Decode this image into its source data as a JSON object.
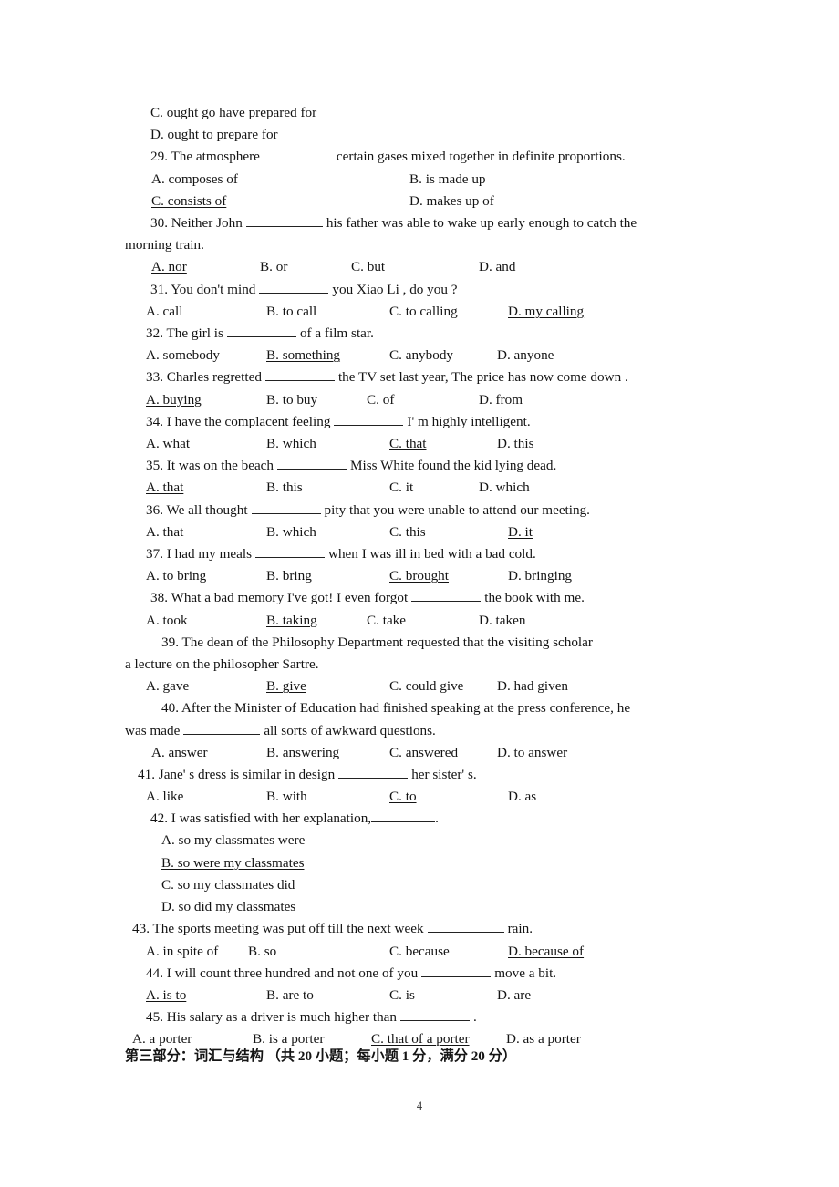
{
  "document": {
    "page_number": "4",
    "section_heading": "第三部分：词汇与结构 （共 20 小题；每小题 1 分，满分 20 分）"
  },
  "carryover": {
    "option_c": "C. ought go have prepared for",
    "option_d": "D. ought to prepare for"
  },
  "questions": [
    {
      "number": "29",
      "stem_before": "29. The atmosphere",
      "stem_after": "certain gases mixed together in definite proportions.",
      "layout": "two-column",
      "options": [
        {
          "label": "A. composes of",
          "correct": false
        },
        {
          "label": "B. is made up",
          "correct": false
        },
        {
          "label": "C. consists of",
          "correct": true
        },
        {
          "label": "D. makes up of",
          "correct": false
        }
      ]
    },
    {
      "number": "30",
      "stem_before": "30. Neither John",
      "stem_after": "his father was able to wake up early enough to catch the",
      "stem_tail": "morning train.",
      "layout": "four-column",
      "options": [
        {
          "label": "A. nor",
          "correct": true
        },
        {
          "label": "B. or",
          "correct": false
        },
        {
          "label": "C. but",
          "correct": false
        },
        {
          "label": "D. and",
          "correct": false
        }
      ]
    },
    {
      "number": "31",
      "stem_before": "31. You don't mind",
      "stem_after": "you Xiao Li , do you ?",
      "layout": "four-column",
      "options": [
        {
          "label": "A. call",
          "correct": false
        },
        {
          "label": "B. to call",
          "correct": false
        },
        {
          "label": "C. to calling",
          "correct": false
        },
        {
          "label": "D. my calling",
          "correct": true
        }
      ]
    },
    {
      "number": "32",
      "stem_before": "32. The girl is",
      "stem_after": "of a film star.",
      "layout": "four-column",
      "options": [
        {
          "label": "A. somebody",
          "correct": false
        },
        {
          "label": "B. something",
          "correct": true
        },
        {
          "label": "C. anybody",
          "correct": false
        },
        {
          "label": "D. anyone",
          "correct": false
        }
      ]
    },
    {
      "number": "33",
      "stem_before": "33. Charles regretted",
      "stem_after": "the TV set last year, The price has now come down .",
      "layout": "four-column",
      "options": [
        {
          "label": "A. buying",
          "correct": true
        },
        {
          "label": "B. to buy",
          "correct": false
        },
        {
          "label": "C. of",
          "correct": false
        },
        {
          "label": "D. from",
          "correct": false
        }
      ]
    },
    {
      "number": "34",
      "stem_before": "34. I have the complacent feeling",
      "stem_after": "I' m highly intelligent.",
      "layout": "four-column",
      "options": [
        {
          "label": "A. what",
          "correct": false
        },
        {
          "label": "B. which",
          "correct": false
        },
        {
          "label": "C. that",
          "correct": true
        },
        {
          "label": "D. this",
          "correct": false
        }
      ]
    },
    {
      "number": "35",
      "stem_before": "35. It was on the beach",
      "stem_after": "Miss White found the kid lying dead.",
      "layout": "four-column",
      "options": [
        {
          "label": "A. that",
          "correct": true
        },
        {
          "label": "B. this",
          "correct": false
        },
        {
          "label": "C. it",
          "correct": false
        },
        {
          "label": "D. which",
          "correct": false
        }
      ]
    },
    {
      "number": "36",
      "stem_before": "36. We all thought",
      "stem_after": "pity that you were unable to attend our meeting.",
      "layout": "four-column",
      "options": [
        {
          "label": "A. that",
          "correct": false
        },
        {
          "label": "B. which",
          "correct": false
        },
        {
          "label": "C. this",
          "correct": false
        },
        {
          "label": "D. it",
          "correct": true
        }
      ]
    },
    {
      "number": "37",
      "stem_before": "37. I had my meals",
      "stem_after": "when I was ill in bed with a bad cold.",
      "layout": "four-column",
      "options": [
        {
          "label": "A. to bring",
          "correct": false
        },
        {
          "label": "B. bring",
          "correct": false
        },
        {
          "label": "C. brought",
          "correct": true
        },
        {
          "label": "D. bringing",
          "correct": false
        }
      ]
    },
    {
      "number": "38",
      "stem_before": "38. What a bad memory I've got! I even forgot",
      "stem_after": "the book with me.",
      "layout": "four-column",
      "options": [
        {
          "label": "A. took",
          "correct": false
        },
        {
          "label": "B. taking",
          "correct": true
        },
        {
          "label": "C. take",
          "correct": false
        },
        {
          "label": "D. taken",
          "correct": false
        }
      ]
    },
    {
      "number": "39",
      "stem_wrapped": "39. The dean of the Philosophy Department requested that the visiting scholar",
      "stem_tail": "a lecture on the philosopher Sartre.",
      "layout": "four-column",
      "options": [
        {
          "label": "A. gave",
          "correct": false
        },
        {
          "label": "B. give",
          "correct": true
        },
        {
          "label": "C. could give",
          "correct": false
        },
        {
          "label": "D. had given",
          "correct": false
        }
      ]
    },
    {
      "number": "40",
      "stem_wrapped": "40. After the Minister of Education had finished speaking at the press conference, he",
      "stem_tail_before": "was made",
      "stem_tail_after": "all sorts of awkward questions.",
      "layout": "four-column",
      "options": [
        {
          "label": "A. answer",
          "correct": false
        },
        {
          "label": "B. answering",
          "correct": false
        },
        {
          "label": "C. answered",
          "correct": false
        },
        {
          "label": "D. to answer",
          "correct": true
        }
      ]
    },
    {
      "number": "41",
      "stem_before": "41. Jane' s dress is similar in design",
      "stem_after": "her sister' s.",
      "layout": "four-column",
      "options": [
        {
          "label": "A. like",
          "correct": false
        },
        {
          "label": "B. with",
          "correct": false
        },
        {
          "label": "C. to",
          "correct": true
        },
        {
          "label": "D. as",
          "correct": false
        }
      ]
    },
    {
      "number": "42",
      "stem_before": "42. I was satisfied with her explanation,",
      "stem_after": ".",
      "layout": "stacked",
      "options": [
        {
          "label": "A. so my classmates were",
          "correct": false
        },
        {
          "label": "B. so were my classmates",
          "correct": true
        },
        {
          "label": "C. so my classmates did",
          "correct": false
        },
        {
          "label": "D. so did my classmates",
          "correct": false
        }
      ]
    },
    {
      "number": "43",
      "stem_before": "43. The sports meeting was put off till the next week",
      "stem_after": "rain.",
      "layout": "four-column",
      "options": [
        {
          "label": "A. in spite of",
          "correct": false
        },
        {
          "label": "B. so",
          "correct": false
        },
        {
          "label": "C. because",
          "correct": false
        },
        {
          "label": "D. because of",
          "correct": true
        }
      ]
    },
    {
      "number": "44",
      "stem_before": "44. I will count three hundred and not one of you",
      "stem_after": "move a bit.",
      "layout": "four-column",
      "options": [
        {
          "label": "A. is to",
          "correct": true
        },
        {
          "label": "B. are to",
          "correct": false
        },
        {
          "label": "C. is",
          "correct": false
        },
        {
          "label": "D. are",
          "correct": false
        }
      ]
    },
    {
      "number": "45",
      "stem_before": "45. His salary as a driver is much higher than",
      "stem_after": ".",
      "layout": "four-column",
      "options": [
        {
          "label": "A. a porter",
          "correct": false
        },
        {
          "label": "B. is a porter",
          "correct": false
        },
        {
          "label": "C. that of a porter",
          "correct": true
        },
        {
          "label": "D. as a porter",
          "correct": false
        }
      ]
    }
  ]
}
